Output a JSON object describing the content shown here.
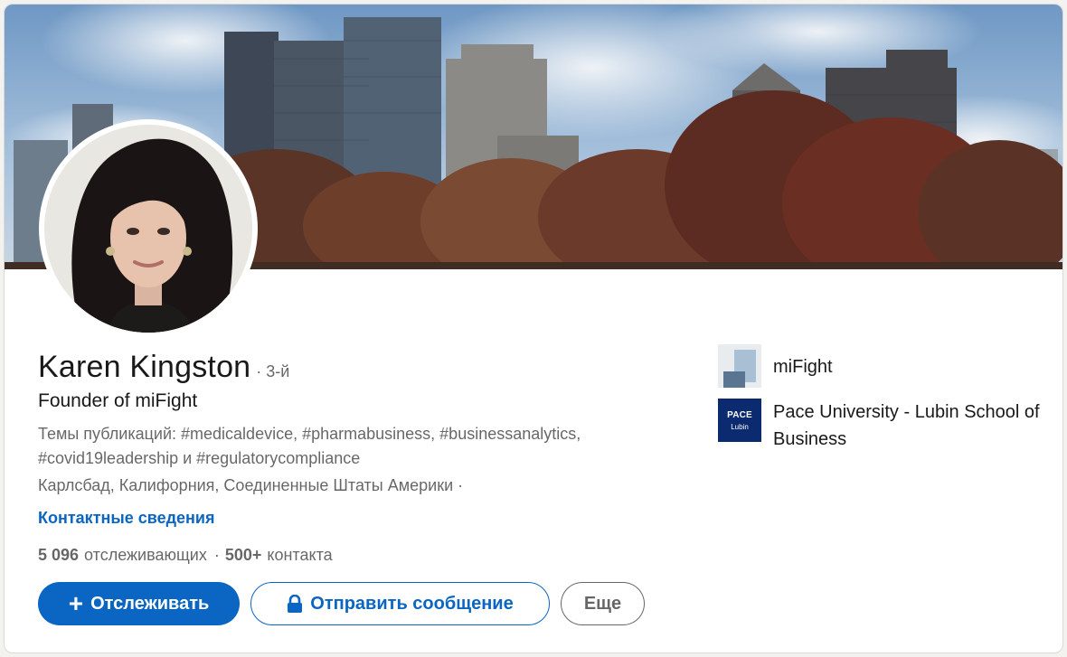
{
  "profile": {
    "name": "Karen Kingston",
    "degree": "· 3-й",
    "headline": "Founder of miFight",
    "topics": "Темы публикаций: #medicaldevice, #pharmabusiness, #businessanalytics, #covid19leadership и #regulatorycompliance",
    "location": "Карлсбад, Калифорния, Соединенные Штаты Америки ·",
    "contact_link": "Контактные сведения"
  },
  "stats": {
    "followers_count": "5 096",
    "followers_label": "отслеживающих",
    "separator": "·",
    "connections_count": "500+",
    "connections_label": "контакта"
  },
  "actions": {
    "follow_label": "Отслеживать",
    "follow_plus": "+",
    "message_label": "Отправить сообщение",
    "more_label": "Еще"
  },
  "organizations": [
    {
      "name": "miFight",
      "logo_icon": "mifight-logo"
    },
    {
      "name": "Pace University - Lubin School of Business",
      "logo_icon": "pace-logo",
      "logo_text": "PACE",
      "logo_subtext": "Lubin"
    }
  ],
  "colors": {
    "accent": "#0a66c2",
    "pace_navy": "#0b2a6f"
  }
}
